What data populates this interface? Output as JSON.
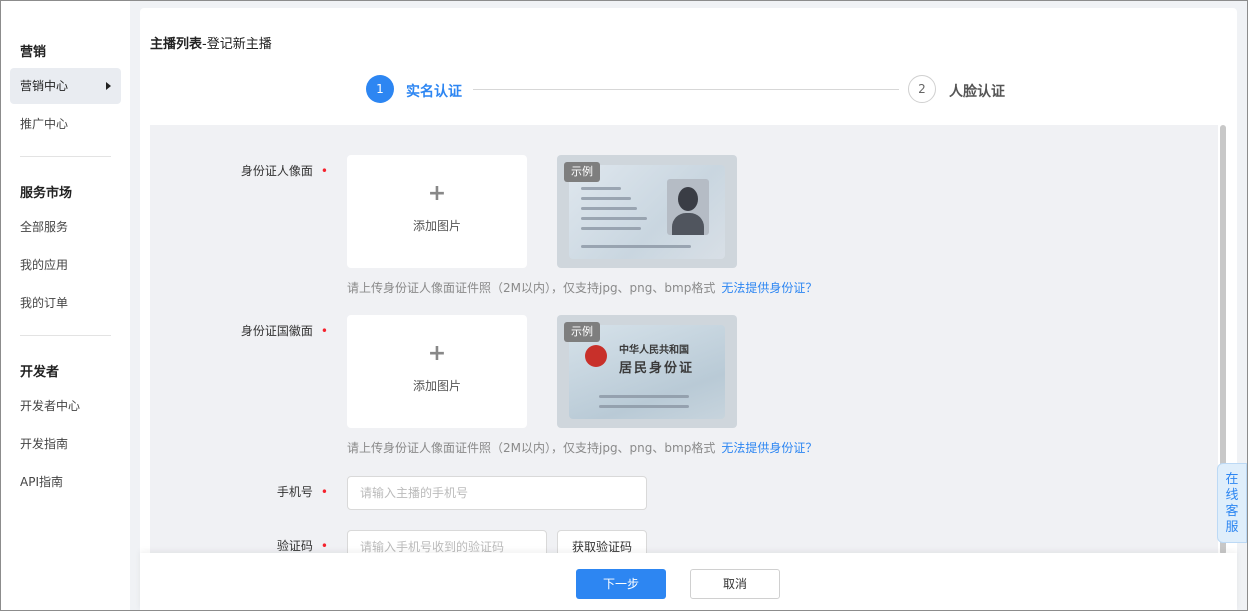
{
  "sidebar": {
    "groups": [
      {
        "title": "营销",
        "items": [
          "营销中心",
          "推广中心"
        ]
      },
      {
        "title": "服务市场",
        "items": [
          "全部服务",
          "我的应用",
          "我的订单"
        ]
      },
      {
        "title": "开发者",
        "items": [
          "开发者中心",
          "开发指南",
          "API指南"
        ]
      }
    ],
    "active_item": "营销中心"
  },
  "breadcrumb": {
    "parent": "主播列表",
    "separator": "-",
    "current": "登记新主播"
  },
  "steps": [
    {
      "number": "1",
      "label": "实名认证",
      "state": "active"
    },
    {
      "number": "2",
      "label": "人脸认证",
      "state": "inactive"
    }
  ],
  "form": {
    "id_front": {
      "label": "身份证人像面",
      "required_mark": "•",
      "upload_plus": "+",
      "upload_text": "添加图片",
      "sample_tag": "示例",
      "hint": "请上传身份证人像面证件照（2M以内），仅支持jpg、png、bmp格式",
      "hint_link": "无法提供身份证？"
    },
    "id_back": {
      "label": "身份证国徽面",
      "required_mark": "•",
      "upload_plus": "+",
      "upload_text": "添加图片",
      "sample_tag": "示例",
      "sample_card_title_1": "中华人民共和国",
      "sample_card_title_2": "居民身份证",
      "hint": "请上传身份证人像面证件照（2M以内），仅支持jpg、png、bmp格式",
      "hint_link": "无法提供身份证？"
    },
    "phone": {
      "label": "手机号",
      "required_mark": "•",
      "placeholder": "请输入主播的手机号"
    },
    "code": {
      "label": "验证码",
      "required_mark": "•",
      "placeholder": "请输入手机号收到的验证码",
      "button": "获取验证码"
    }
  },
  "footer": {
    "next": "下一步",
    "cancel": "取消"
  },
  "online_service": "在线客服",
  "colors": {
    "accent": "#2d86f2",
    "required": "#f5222d"
  }
}
